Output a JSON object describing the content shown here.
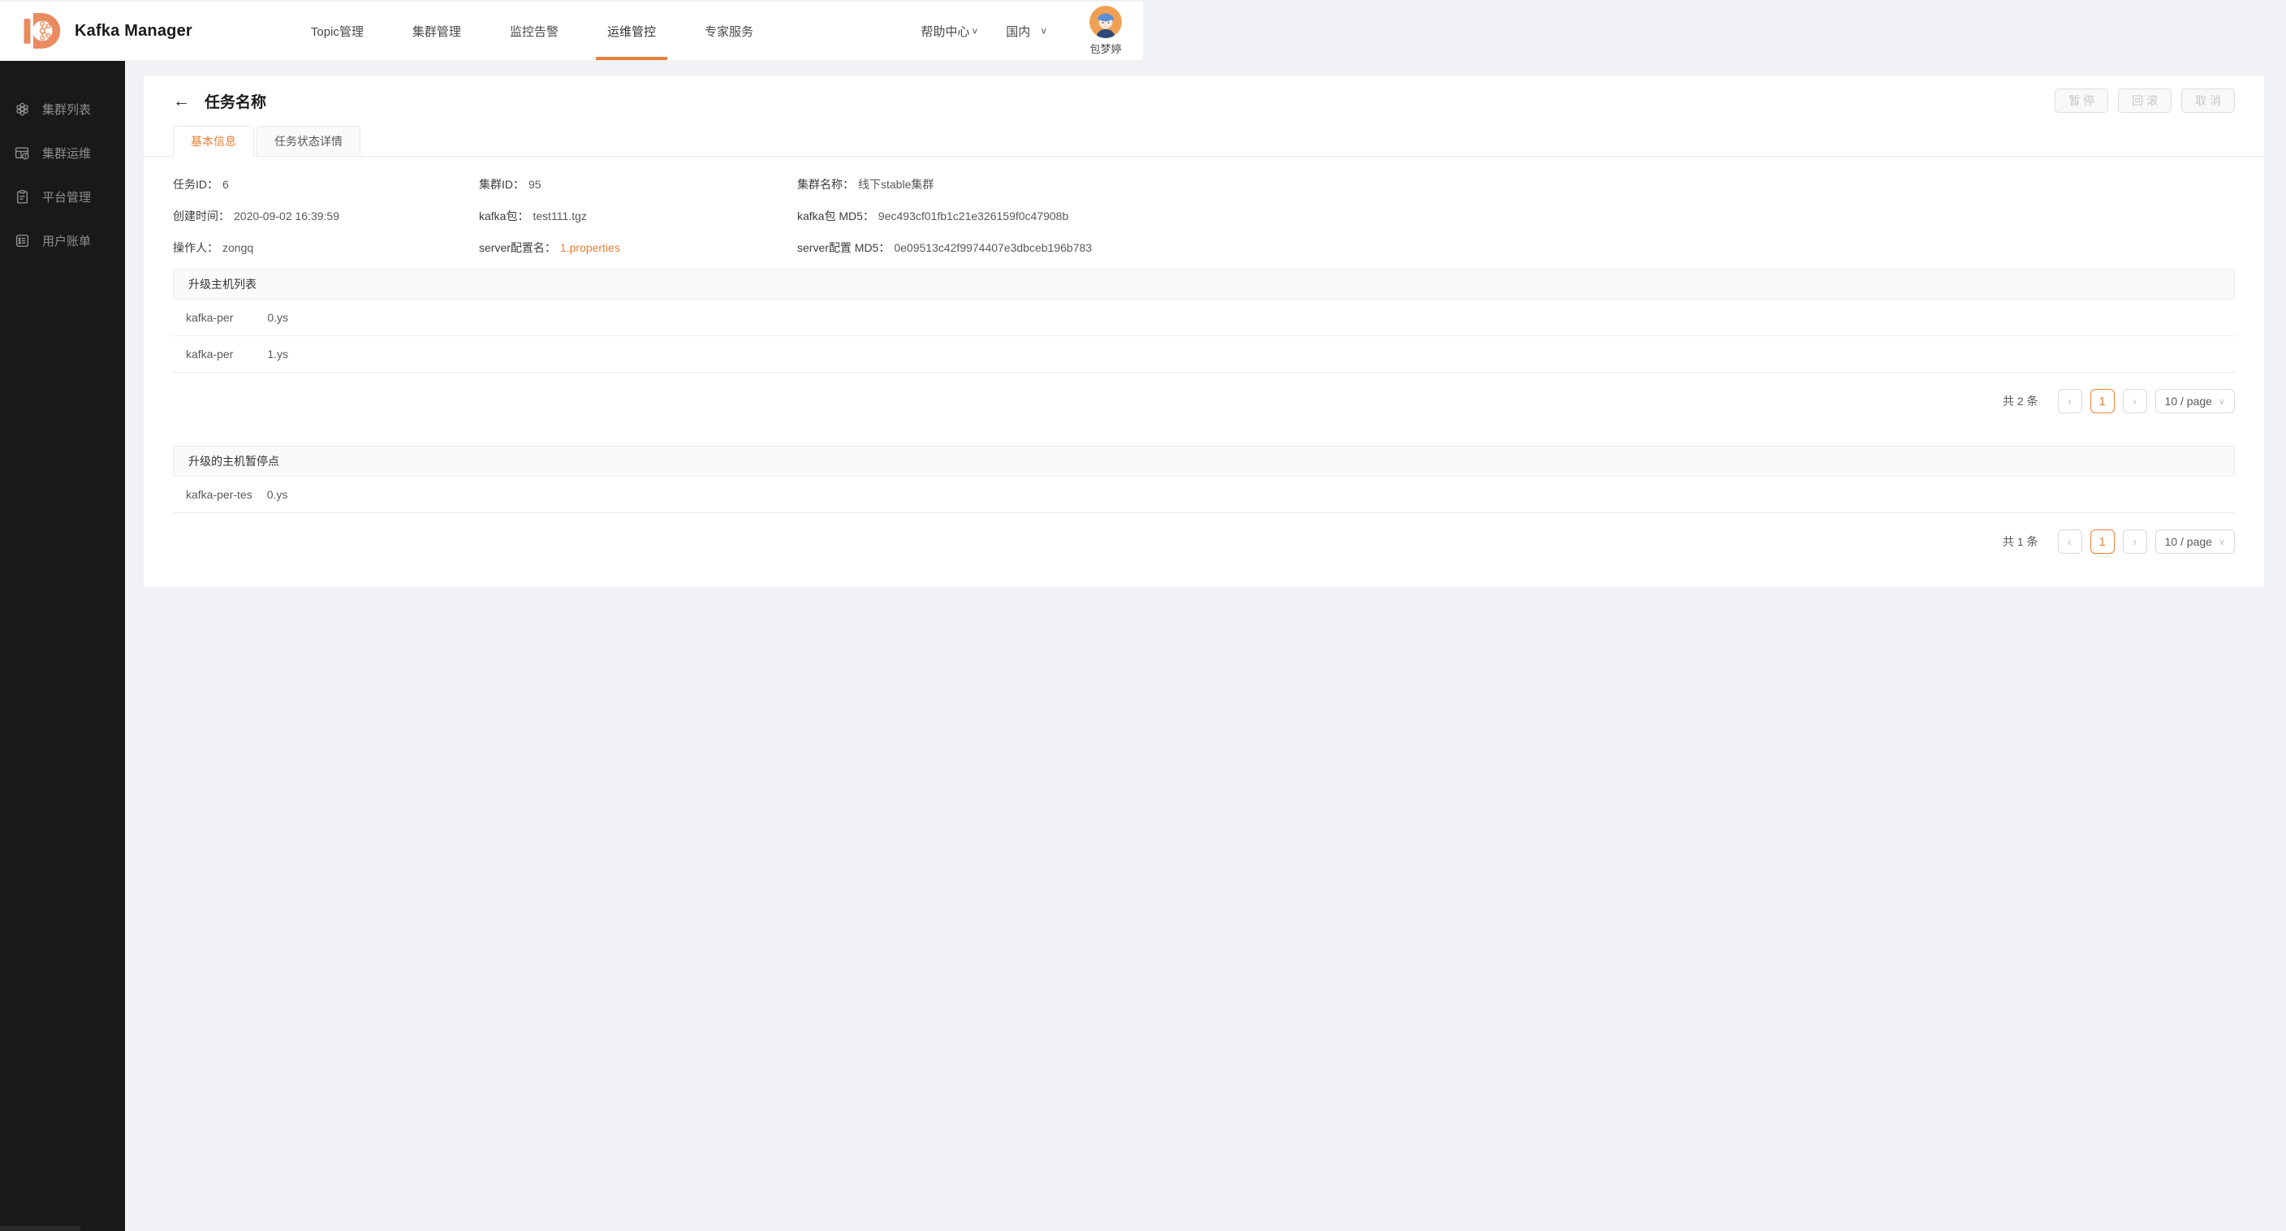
{
  "colors": {
    "accent": "#EC7D33",
    "logo_orange": "#E98B5E",
    "sidebar_bg": "#191919",
    "page_bg": "#F0F2F5"
  },
  "icons": {
    "back_arrow": "←",
    "chevron_down": "∨",
    "prev": "‹",
    "next": "›"
  },
  "header": {
    "app_title": "Kafka Manager",
    "nav": [
      {
        "label": "Topic管理"
      },
      {
        "label": "集群管理"
      },
      {
        "label": "监控告警"
      },
      {
        "label": "运维管控",
        "active": true
      },
      {
        "label": "专家服务"
      }
    ],
    "help_center": "帮助中心",
    "region": "国内",
    "username": "包梦婷"
  },
  "sidebar": {
    "items": [
      {
        "label": "集群列表",
        "icon": "honeycomb-icon"
      },
      {
        "label": "集群运维",
        "icon": "finance-table-icon"
      },
      {
        "label": "平台管理",
        "icon": "clipboard-icon"
      },
      {
        "label": "用户账单",
        "icon": "list-icon"
      }
    ]
  },
  "page": {
    "title": "任务名称",
    "actions": [
      {
        "label": "暂 停",
        "disabled": true
      },
      {
        "label": "回 滚",
        "disabled": true
      },
      {
        "label": "取 消",
        "disabled": true
      }
    ],
    "tabs": [
      {
        "label": "基本信息",
        "active": true
      },
      {
        "label": "任务状态详情",
        "active": false
      }
    ],
    "info": [
      {
        "label": "任务ID：",
        "value": "6"
      },
      {
        "label": "集群ID：",
        "value": "95"
      },
      {
        "label": "集群名称：",
        "value": "线下stable集群"
      },
      {
        "label": "创建时间：",
        "value": "2020-09-02 16:39:59"
      },
      {
        "label": "kafka包：",
        "value": "test111.tgz"
      },
      {
        "label": "kafka包 MD5：",
        "value": "9ec493cf01fb1c21e326159f0c47908b"
      },
      {
        "label": "操作人：",
        "value": "zongq",
        "masked": true
      },
      {
        "label": "server配置名：",
        "value": "1.properties",
        "link": true
      },
      {
        "label": "server配置 MD5：",
        "value": "0e09513c42f9974407e3dbceb196b783"
      }
    ],
    "host_list": {
      "title": "升级主机列表",
      "rows": [
        {
          "prefix": "kafka-",
          "masked": "per",
          "suffix": "0.ys"
        },
        {
          "prefix": "kafka-",
          "masked": "per",
          "suffix": "1.ys"
        }
      ],
      "pagination": {
        "total": "共 2 条",
        "page": "1",
        "page_size": "10 / page"
      }
    },
    "pause_list": {
      "title": "升级的主机暂停点",
      "rows": [
        {
          "prefix": "kafka-",
          "masked": "per-tes",
          "suffix": "0.ys"
        }
      ],
      "pagination": {
        "total": "共 1 条",
        "page": "1",
        "page_size": "10 / page"
      }
    }
  }
}
